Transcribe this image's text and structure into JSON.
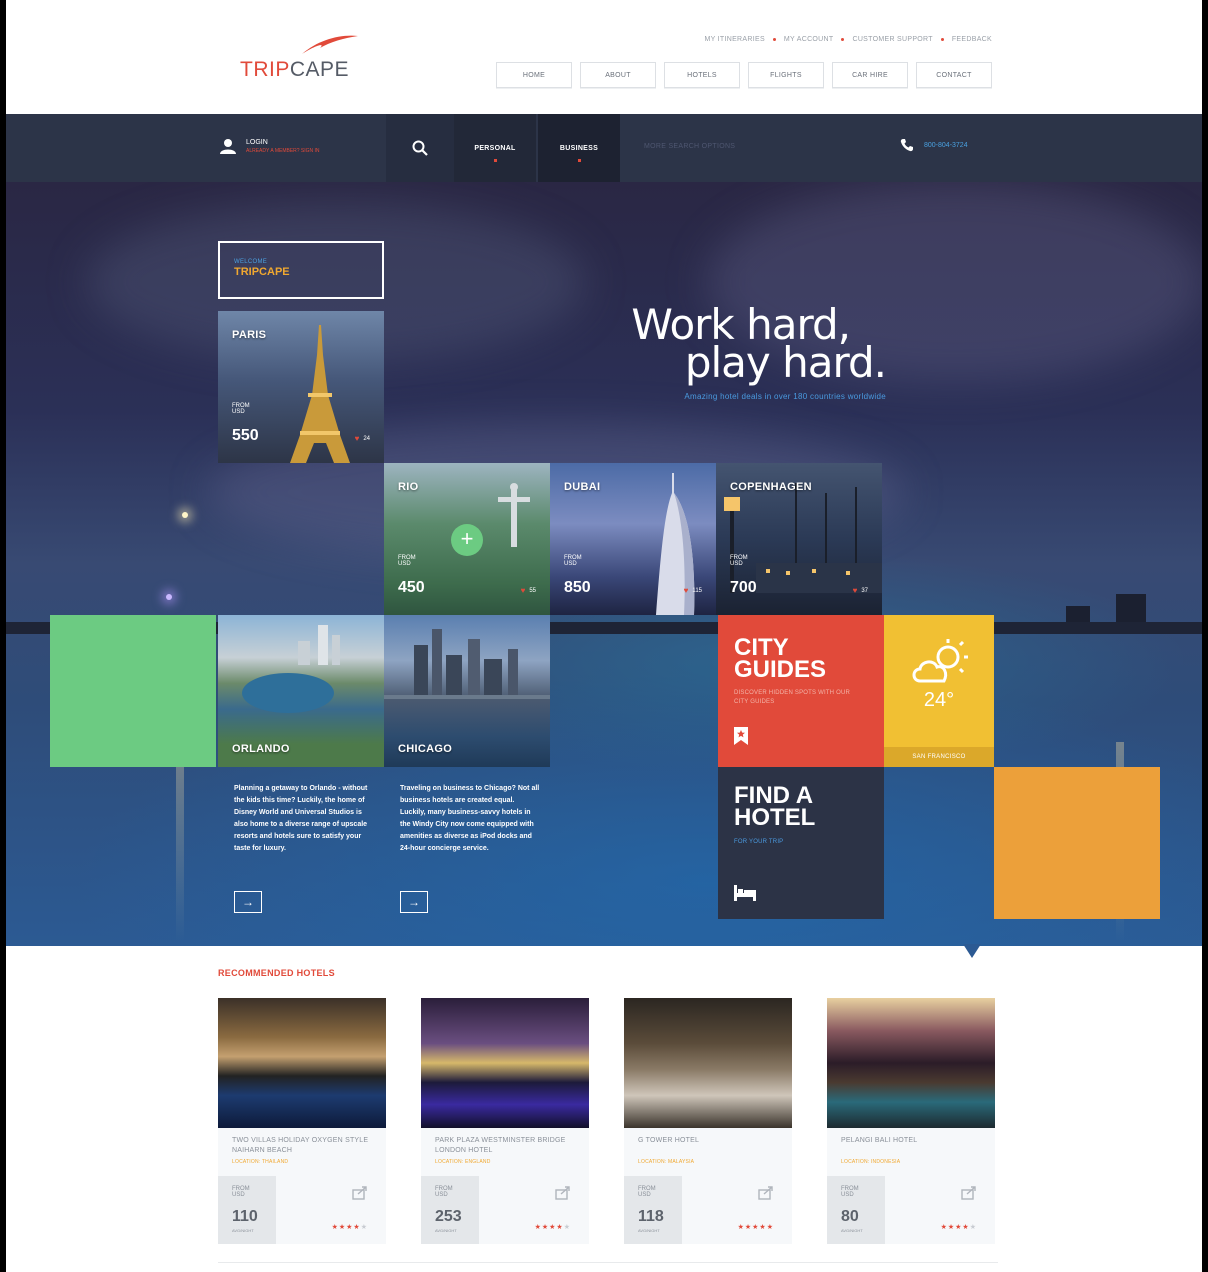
{
  "brand": {
    "name_part1": "TRIP",
    "name_part2": "CAPE",
    "accent": "#e14a3a"
  },
  "toplinks": [
    "MY ITINERARIES",
    "MY ACCOUNT",
    "CUSTOMER SUPPORT",
    "FEEDBACK"
  ],
  "nav": [
    "HOME",
    "ABOUT",
    "HOTELS",
    "FLIGHTS",
    "CAR HIRE",
    "CONTACT"
  ],
  "topbar": {
    "login_label": "LOGIN",
    "login_sub": "ALREADY A MEMBER? SIGN IN",
    "tabs": [
      "PERSONAL",
      "BUSINESS"
    ],
    "more_search": "MORE SEARCH OPTIONS",
    "phone": "800-804-3724"
  },
  "welcome": {
    "line1": "WELCOME",
    "line2": "TRIPCAPE"
  },
  "headline": {
    "line1": "Work hard,",
    "line2": "play hard.",
    "sub": "Amazing hotel deals in over 180 countries worldwide"
  },
  "destinations": [
    {
      "name": "PARIS",
      "from": "FROM",
      "currency": "USD",
      "price": "550",
      "likes": "24"
    },
    {
      "name": "RIO",
      "from": "FROM",
      "currency": "USD",
      "price": "450",
      "likes": "55"
    },
    {
      "name": "DUBAI",
      "from": "FROM",
      "currency": "USD",
      "price": "850",
      "likes": "115"
    },
    {
      "name": "COPENHAGEN",
      "from": "FROM",
      "currency": "USD",
      "price": "700",
      "likes": "37"
    },
    {
      "name": "ORLANDO"
    },
    {
      "name": "CHICAGO"
    }
  ],
  "descriptions": {
    "orlando": "Planning a getaway to Orlando - without the kids this time? Luckily, the home of Disney World and Universal Studios is also home to a diverse range of upscale resorts and hotels sure to satisfy your taste for luxury.",
    "chicago": "Traveling on business to Chicago? Not all business hotels are created equal. Luckily, many business-savvy hotels in the Windy City now come equipped with amenities as diverse as iPod docks and 24-hour concierge service."
  },
  "city_guides": {
    "title": "CITY GUIDES",
    "sub": "DISCOVER HIDDEN SPOTS WITH OUR CITY GUIDES"
  },
  "weather": {
    "temp": "24°",
    "city": "SAN FRANCISCO"
  },
  "find_hotel": {
    "title": "FIND A HOTEL",
    "sub": "FOR YOUR TRIP"
  },
  "recommended": {
    "title": "RECOMMENDED HOTELS",
    "hotels": [
      {
        "name": "TWO VILLAS HOLIDAY OXYGEN STYLE NAIHARN BEACH",
        "location": "LOCATION: THAILAND",
        "from": "FROM",
        "currency": "USD",
        "price": "110",
        "per": "AVG/NIGHT",
        "stars": 4
      },
      {
        "name": "PARK PLAZA WESTMINSTER BRIDGE LONDON HOTEL",
        "location": "LOCATION: ENGLAND",
        "from": "FROM",
        "currency": "USD",
        "price": "253",
        "per": "AVG/NIGHT",
        "stars": 4
      },
      {
        "name": "G TOWER HOTEL",
        "location": "LOCATION: MALAYSIA",
        "from": "FROM",
        "currency": "USD",
        "price": "118",
        "per": "AVG/NIGHT",
        "stars": 5
      },
      {
        "name": "PELANGI BALI HOTEL",
        "location": "LOCATION: INDONESIA",
        "from": "FROM",
        "currency": "USD",
        "price": "80",
        "per": "AVG/NIGHT",
        "stars": 4
      }
    ]
  }
}
